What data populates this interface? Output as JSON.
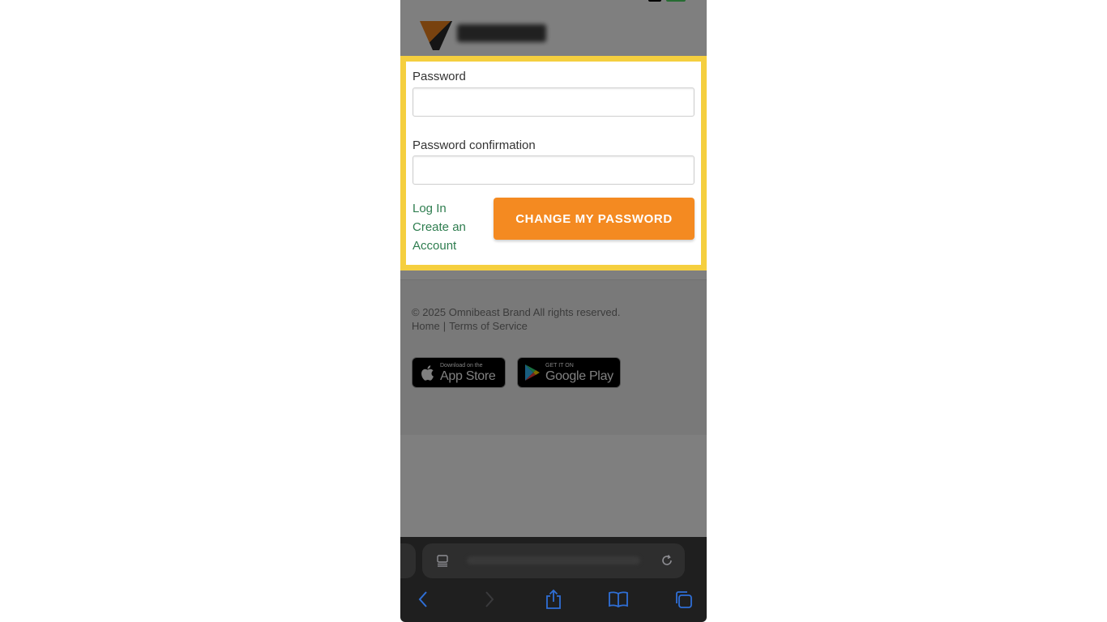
{
  "form": {
    "password_label": "Password",
    "password_value": "",
    "confirm_label": "Password confirmation",
    "confirm_value": "",
    "links": [
      "Log In",
      "Create an Account"
    ],
    "submit_label": "CHANGE MY PASSWORD"
  },
  "footer": {
    "copyright": "© 2025 Omnibeast Brand All rights reserved.",
    "links": [
      "Home",
      "|",
      "Terms of Service"
    ]
  },
  "badges": {
    "appstore_small": "Download on the",
    "appstore_big": "App Store",
    "google_small": "GET IT ON",
    "google_big": "Google Play"
  },
  "colors": {
    "highlight": "#f5cf3f",
    "accent": "#f48a21",
    "link": "#2e7d4f"
  },
  "icons": [
    "apple-icon",
    "google-play-icon",
    "reader-icon",
    "reload-icon",
    "back-icon",
    "forward-icon",
    "share-icon",
    "bookmarks-icon",
    "tabs-icon"
  ]
}
